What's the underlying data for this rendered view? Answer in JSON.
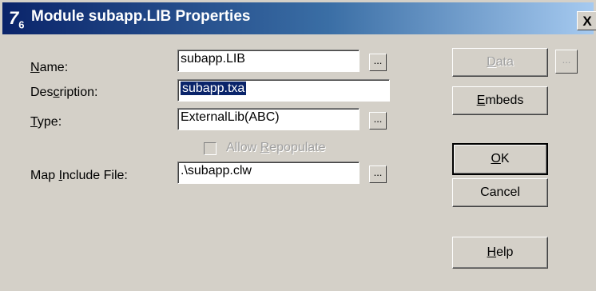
{
  "window": {
    "title": "Module subapp.LIB Properties",
    "icon_name": "app-icon",
    "close_label": "X"
  },
  "form": {
    "name_label": "Name:",
    "name_value": "subapp.LIB",
    "description_label": "Description:",
    "description_value": "subapp.txa",
    "type_label": "Type:",
    "type_value": "ExternalLib(ABC)",
    "allow_repopulate_label": "Allow Repopulate",
    "allow_repopulate_checked": false,
    "map_include_label": "Map Include File:",
    "map_include_value": ".\\subapp.clw",
    "browse_label": "..."
  },
  "buttons": {
    "data": "Data",
    "data_browse": "...",
    "embeds": "Embeds",
    "ok": "OK",
    "cancel": "Cancel",
    "help": "Help"
  }
}
